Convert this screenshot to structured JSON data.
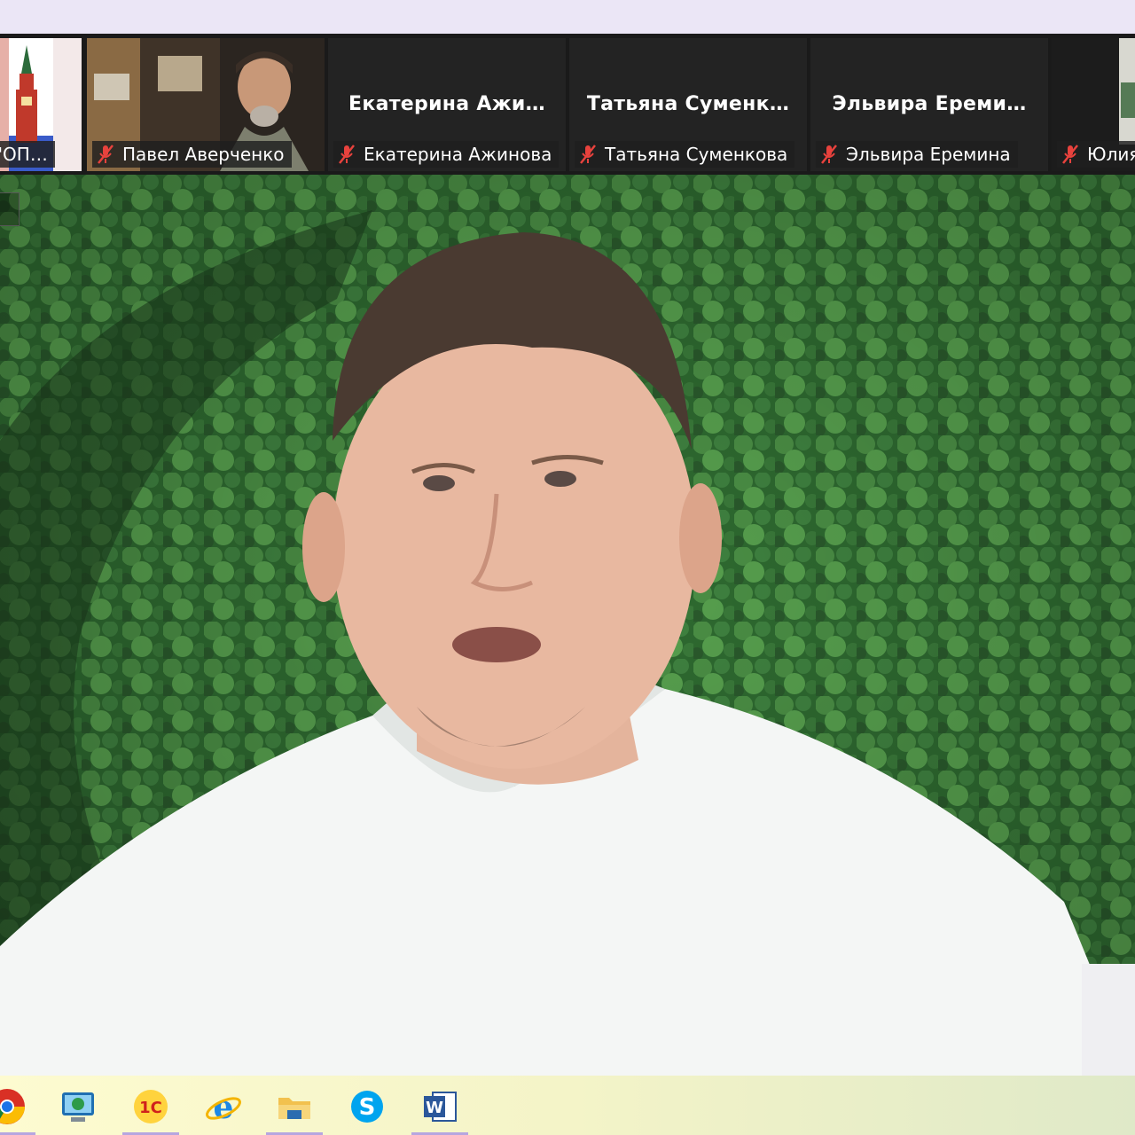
{
  "gallery": {
    "tiles": [
      {
        "label": "ут \"ОП…",
        "center_name": "",
        "has_video": true
      },
      {
        "label": "Павел Аверченко",
        "center_name": "",
        "has_video": true
      },
      {
        "label": "Екатерина Ажинова",
        "center_name": "Екатерина  Ажи…",
        "has_video": false
      },
      {
        "label": "Татьяна Суменкова",
        "center_name": "Татьяна  Суменк…",
        "has_video": false
      },
      {
        "label": "Эльвира Еремина",
        "center_name": "Эльвира  Ереми…",
        "has_video": false
      },
      {
        "label": "Юлия",
        "center_name": "",
        "has_video": true
      }
    ],
    "muted_icon": "mic-muted-icon",
    "muted_color": "#e8423d"
  },
  "main_video": {
    "subject": "active speaker video"
  },
  "taskbar": {
    "items": [
      {
        "icon": "chrome-icon"
      },
      {
        "icon": "remote-desktop-icon"
      },
      {
        "icon": "1c-icon",
        "text": "1С"
      },
      {
        "icon": "internet-explorer-icon",
        "text": "e"
      },
      {
        "icon": "file-explorer-icon"
      },
      {
        "icon": "skype-icon",
        "text": "S"
      },
      {
        "icon": "word-icon",
        "text": "W"
      }
    ]
  }
}
